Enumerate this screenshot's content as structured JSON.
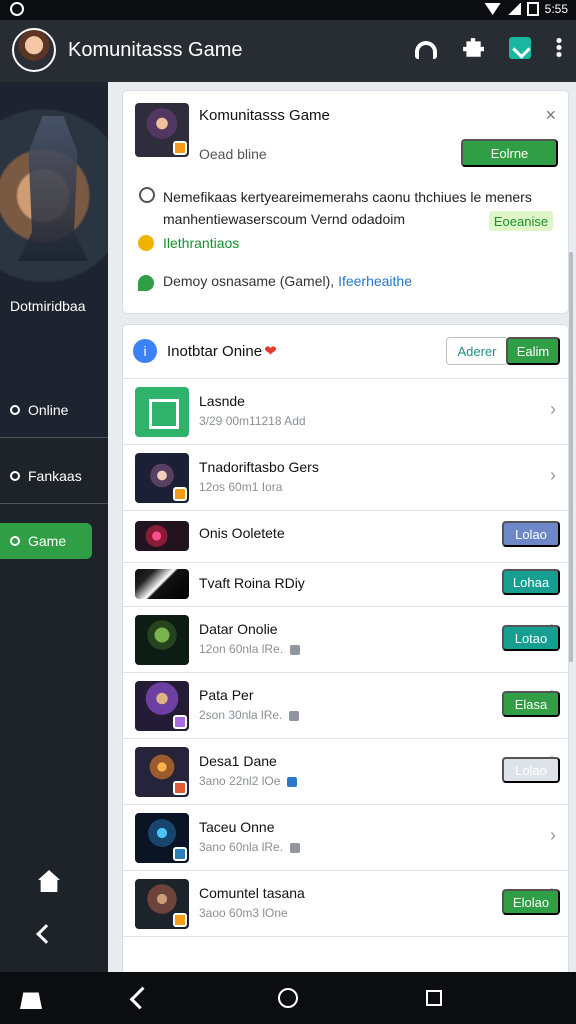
{
  "app": {
    "title": "Komunitasss Game",
    "status_time": "5:55"
  },
  "sidebar": {
    "hero_label": "Dotmiridbaa",
    "items": [
      {
        "label": "Online"
      },
      {
        "label": "Fankaas"
      },
      {
        "label": "Game"
      }
    ]
  },
  "top_card": {
    "title": "Komunitasss Game",
    "subtitle": "Oead bline",
    "online_button": "Eolrne",
    "description": "Nemefikaas kertyeareimemerahs caonu thchiues le meners manhentiewaserscoum Vernd odadoim",
    "tag": "Eoeanise",
    "link": "Ilethrantiaos",
    "demo_prefix": "Demoy osnasame (Gamel),",
    "demo_link": "Ifeerheaithe"
  },
  "list": {
    "header": "Inotbtar Onine",
    "add_button": "Aderer",
    "online_button": "Ealim",
    "rows": [
      {
        "name": "Lasnde",
        "meta": "3/29 00m11218 Add",
        "action": ""
      },
      {
        "name": "Tnadoriftasbo Gers",
        "meta": "12os 60m1 Iora",
        "action": ""
      },
      {
        "name": "Onis Ooletete",
        "meta": "",
        "action": "Lolao"
      },
      {
        "name": "Tvaft Roina RDiy",
        "meta": "",
        "action": "Lohaa"
      },
      {
        "name": "Datar Onolie",
        "meta": "12on 60nla lRe.",
        "action": "Lotao"
      },
      {
        "name": "Pata Per",
        "meta": "2son 30nla lRe.",
        "action": "Elasa"
      },
      {
        "name": "Desa1 Dane",
        "meta": "3ano 22nl2 lOe",
        "action": "Lolao"
      },
      {
        "name": "Taceu Onne",
        "meta": "3ano 60nla lRe.",
        "action": ""
      },
      {
        "name": "Comuntel tasana",
        "meta": "3aoo 60m3 lOne",
        "action": "Elolao"
      }
    ]
  }
}
